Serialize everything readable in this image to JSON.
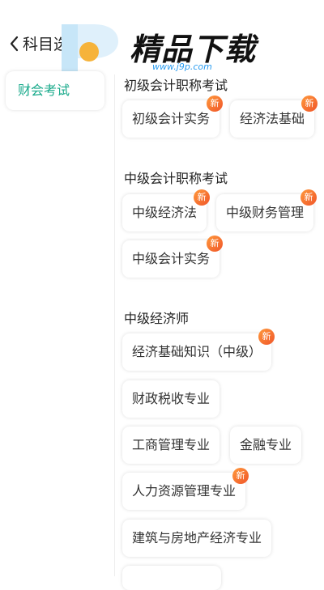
{
  "header": {
    "title": "科目选择"
  },
  "watermark": {
    "brand": "精品下载",
    "url": "www.j9p.com"
  },
  "sidebar": {
    "items": [
      {
        "label": "财会考试"
      }
    ]
  },
  "badge_text": "新",
  "groups": [
    {
      "title": "初级会计职称考试",
      "chips": [
        {
          "label": "初级会计实务"
        },
        {
          "label": "经济法基础"
        }
      ]
    },
    {
      "title": "中级会计职称考试",
      "chips": [
        {
          "label": "中级经济法"
        },
        {
          "label": "中级财务管理"
        },
        {
          "label": "中级会计实务"
        }
      ]
    },
    {
      "title": "中级经济师",
      "chips": [
        {
          "label": "经济基础知识（中级）"
        },
        {
          "label": "财政税收专业"
        },
        {
          "label": "工商管理专业"
        },
        {
          "label": "金融专业"
        },
        {
          "label": "人力资源管理专业"
        },
        {
          "label": "建筑与房地产经济专业"
        }
      ]
    }
  ],
  "colors": {
    "accent": "#17a98a",
    "badge": "#f0552a",
    "url": "#2b9cf0"
  }
}
